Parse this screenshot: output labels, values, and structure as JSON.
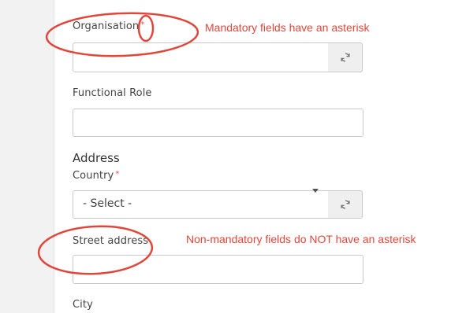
{
  "form": {
    "organisation": {
      "label": "Organisation",
      "required_mark": "*",
      "value": ""
    },
    "functional_role": {
      "label": "Functional Role",
      "value": ""
    },
    "address": {
      "heading": "Address",
      "country": {
        "label": "Country",
        "required_mark": "*",
        "selected": "- Select -"
      },
      "street": {
        "label": "Street address",
        "value": ""
      },
      "city": {
        "label": "City"
      }
    }
  },
  "annotations": {
    "mandatory_note": "Mandatory fields have an asterisk",
    "optional_note": "Non-mandatory fields do NOT have an asterisk"
  },
  "colors": {
    "annotation": "#e0463a",
    "required": "#d9534f"
  }
}
